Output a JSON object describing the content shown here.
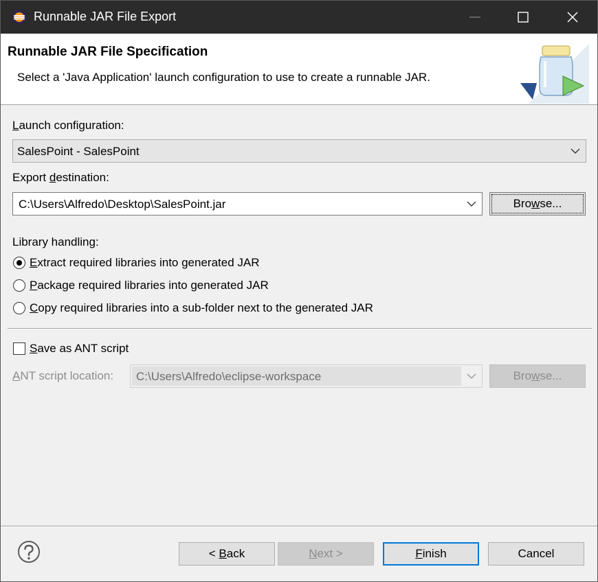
{
  "window": {
    "title": "Runnable JAR File Export",
    "app_icon": "eclipse-icon",
    "controls": [
      "minimize-icon",
      "maximize-icon",
      "close-icon"
    ]
  },
  "banner": {
    "heading": "Runnable JAR File Specification",
    "description": "Select a 'Java Application' launch configuration to use to create a runnable JAR.",
    "icon": "jar-export-icon"
  },
  "launch": {
    "label_pre": "",
    "label_key": "L",
    "label_post": "aunch configuration:",
    "value": "SalesPoint - SalesPoint"
  },
  "export": {
    "label_pre": "Export ",
    "label_key": "d",
    "label_post": "estination:",
    "value": "C:\\Users\\Alfredo\\Desktop\\SalesPoint.jar",
    "browse_pre": "Bro",
    "browse_key": "w",
    "browse_post": "se..."
  },
  "library": {
    "label": "Library handling:",
    "options": [
      {
        "key": "E",
        "rest": "xtract required libraries into generated JAR",
        "checked": true
      },
      {
        "key": "P",
        "rest": "ackage required libraries into generated JAR",
        "checked": false
      },
      {
        "key": "C",
        "rest": "opy required libraries into a sub-folder next to the generated JAR",
        "checked": false
      }
    ]
  },
  "ant": {
    "checkbox_key": "S",
    "checkbox_rest": "ave as ANT script",
    "checked": false,
    "location_key": "A",
    "location_rest": "NT script location:",
    "location_value": "C:\\Users\\Alfredo\\eclipse-workspace",
    "browse_pre": "Bro",
    "browse_key": "w",
    "browse_post": "se..."
  },
  "footer": {
    "help_icon": "help-icon",
    "back_pre": "< ",
    "back_key": "B",
    "back_post": "ack",
    "next_key": "N",
    "next_post": "ext >",
    "finish_key": "F",
    "finish_post": "inish",
    "cancel": "Cancel"
  }
}
